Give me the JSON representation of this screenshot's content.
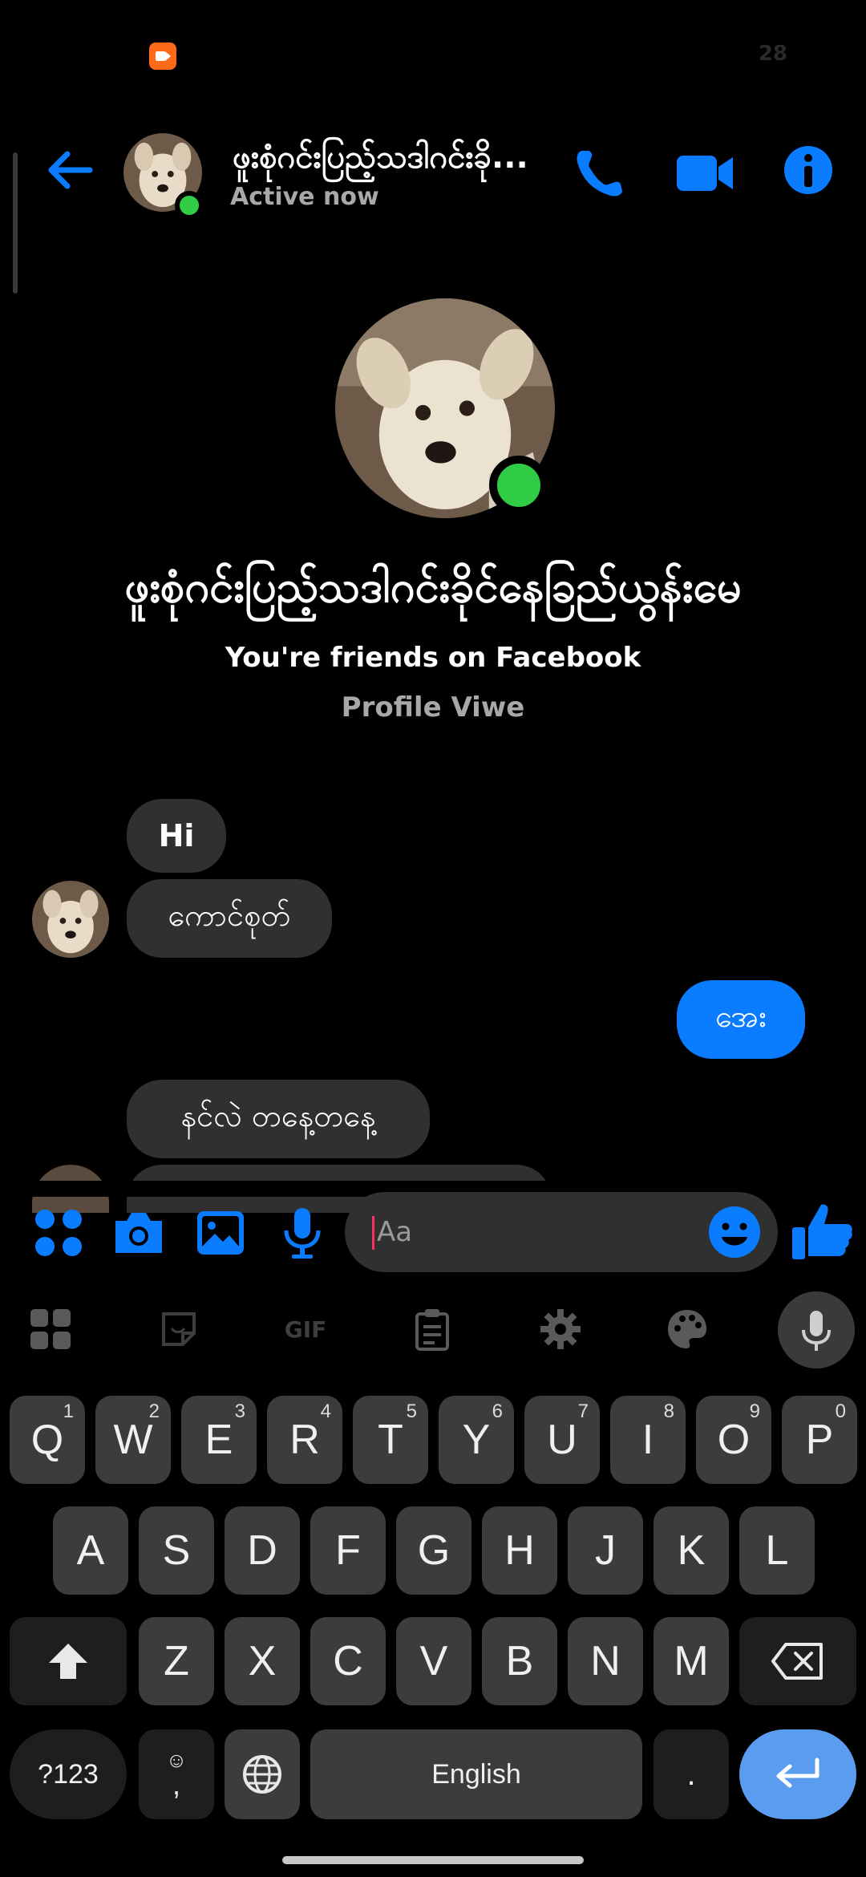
{
  "status_bar": {
    "time": "28"
  },
  "header": {
    "name": "ဖူးစုံဂင်းပြည့်သဒါဂင်းခို...",
    "status": "Active now"
  },
  "profile": {
    "name": "ဖူးစုံဂင်းပြည့်သဒါဂင်းခိုင်နေခြည်ယွန်းမေ",
    "friends_text": "You're friends on Facebook",
    "link_label": "Profile Viwe"
  },
  "messages": [
    {
      "direction": "in",
      "text": "Hi"
    },
    {
      "direction": "in",
      "text": "ကောင်စုတ်"
    },
    {
      "direction": "out",
      "text": "အေး"
    },
    {
      "direction": "in",
      "text": "နင်လဲ တနေ့တနေ့"
    }
  ],
  "composer": {
    "placeholder": "Aa"
  },
  "keyboard": {
    "toolbar": [
      "apps-icon",
      "sticker-icon",
      "GIF",
      "clipboard-icon",
      "settings-icon",
      "palette-icon",
      "mic-icon"
    ],
    "gif_label": "GIF",
    "row1": [
      {
        "k": "Q",
        "n": "1"
      },
      {
        "k": "W",
        "n": "2"
      },
      {
        "k": "E",
        "n": "3"
      },
      {
        "k": "R",
        "n": "4"
      },
      {
        "k": "T",
        "n": "5"
      },
      {
        "k": "Y",
        "n": "6"
      },
      {
        "k": "U",
        "n": "7"
      },
      {
        "k": "I",
        "n": "8"
      },
      {
        "k": "O",
        "n": "9"
      },
      {
        "k": "P",
        "n": "0"
      }
    ],
    "row2": [
      "A",
      "S",
      "D",
      "F",
      "G",
      "H",
      "J",
      "K",
      "L"
    ],
    "row3": [
      "Z",
      "X",
      "C",
      "V",
      "B",
      "N",
      "M"
    ],
    "symbols_label": "?123",
    "comma_label": ",",
    "space_label": "English",
    "period_label": "."
  },
  "colors": {
    "accent": "#0a7cff",
    "online": "#31cc46",
    "bubble_in": "#303030",
    "enter_key": "#5a9cf0"
  }
}
